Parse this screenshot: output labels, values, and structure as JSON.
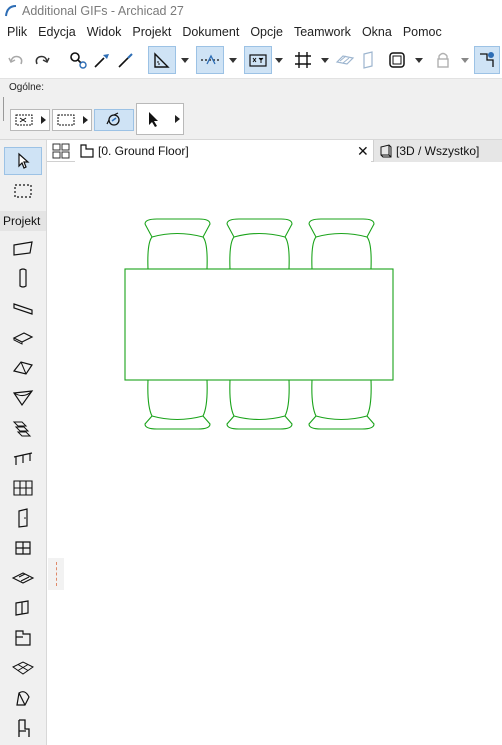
{
  "window": {
    "title": "Additional GIFs - Archicad 27"
  },
  "menu": [
    "Plik",
    "Edycja",
    "Widok",
    "Projekt",
    "Dokument",
    "Opcje",
    "Teamwork",
    "Okna",
    "Pomoc"
  ],
  "infobox": {
    "label": "Ogólne:"
  },
  "toolbox": {
    "section_label": "Projekt",
    "tools": [
      "arrow-tool",
      "marquee-tool",
      "wall-tool",
      "column-tool",
      "beam-tool",
      "slab-tool",
      "roof-tool",
      "shell-tool",
      "stair-tool",
      "railing-tool",
      "curtain-wall-tool",
      "door-tool",
      "window-tool",
      "skylight-tool",
      "wall-end-tool",
      "corner-window-tool",
      "mesh-tool",
      "morph-tool",
      "object-tool"
    ]
  },
  "tabs": {
    "active_label": "[0. Ground Floor]",
    "close_symbol": "✕",
    "inactive_label": "[3D / Wszystko]"
  },
  "colors": {
    "selection": "#cfe3f5",
    "drawing_green": "#1aa31a",
    "accent_blue": "#2d6db5"
  }
}
